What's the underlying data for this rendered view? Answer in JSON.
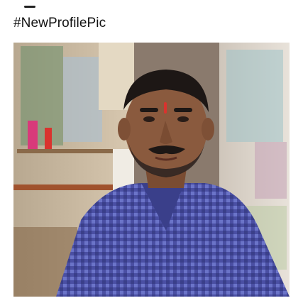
{
  "post": {
    "caption": "#NewProfilePic"
  },
  "photo": {
    "subject": "man-portrait",
    "colors": {
      "shirt": "#4a4fa3",
      "shirt_check": "#6b74c8",
      "skin": "#8a5a3e",
      "hair": "#1d1715",
      "wall_left": "#c8b8a2",
      "wall_right": "#d9d2c8",
      "accent_pink": "#d83a7a",
      "accent_red": "#d9332e"
    }
  }
}
